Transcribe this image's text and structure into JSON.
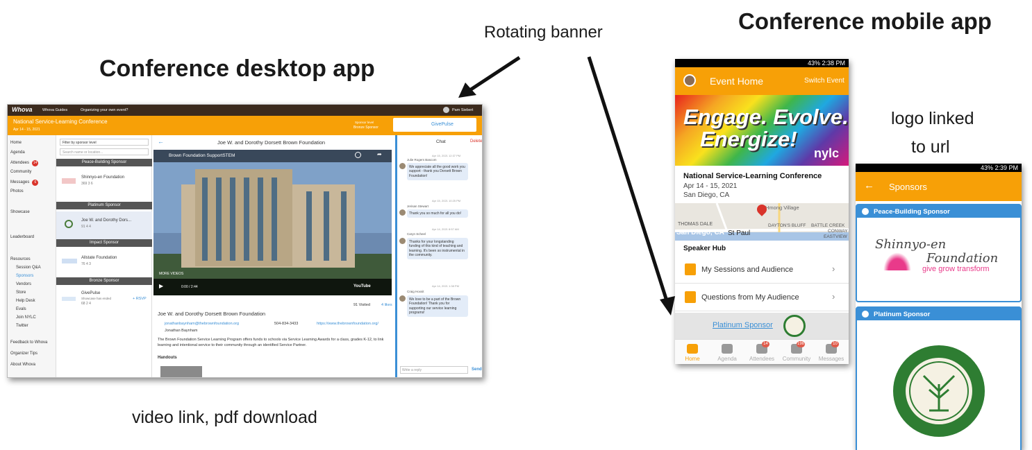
{
  "captions": {
    "desktop_title": "Conference desktop app",
    "mobile_title": "Conference mobile app",
    "rotating_banner": "Rotating banner",
    "logo_linked": "logo linked",
    "to_url": "to url",
    "video_link": "video link, pdf download"
  },
  "desktop": {
    "brand": "Whova",
    "menu_guides": "Whova Guides",
    "menu_organize": "Organizing your own event?",
    "user": "Pam Siebert",
    "event_name": "National Service-Learning Conference",
    "event_dates": "Apr 14 - 15, 2021",
    "sponsor_level_label": "Sponsor level",
    "sponsor_level": "Bronze Sponsor",
    "banner_logo": "GivePulse",
    "nav": [
      "Home",
      "Agenda",
      "Attendees",
      "Community",
      "Messages",
      "Photos",
      "Showcase",
      "Leaderboard",
      "Resources",
      "Session Q&A",
      "Sponsors",
      "Vendors",
      "Store",
      "Help Desk",
      "Evals",
      "Join NYLC",
      "Twitter",
      "Feedback to Whova",
      "Organizer Tips",
      "About Whova"
    ],
    "nav_badges": {
      "attendees": "14",
      "messages": "6"
    },
    "filter_placeholder": "Filter by sponsor level",
    "search_placeholder": "Search name or location...",
    "sections": [
      "Peace-Building Sponsor",
      "Platinum Sponsor",
      "Impact Sponsor",
      "Bronze Sponsor"
    ],
    "sponsors": [
      {
        "name": "Shinnyo-en Foundation",
        "stats": "369  3  6"
      },
      {
        "name": "Joe W. and Dorothy Dors...",
        "stats": "91  4  4"
      },
      {
        "name": "Allstate Foundation",
        "stats": "76  4  3"
      },
      {
        "name": "GivePulse",
        "sub": "Showcase has ended",
        "stats": "68  2  4",
        "rsvp": "+ RSVP"
      }
    ],
    "detail_title": "Joe W. and Dorothy Dorsett Brown Foundation",
    "video_title": "Brown Foundation SupportSTEM",
    "video_more": "MORE VIDEOS",
    "video_time": "0:00 / 2:44",
    "video_watch_later": "Watch later",
    "video_share": "Share",
    "video_youtube": "YouTube",
    "visited": "91 Visited",
    "likes": "4 likes",
    "org_name": "Joe W. and Dorothy Dorsett Brown Foundation",
    "email": "jonathanbaynham@thebrownfoundation.org",
    "phone": "504-834-3433",
    "website": "https://www.thebrownfoundation.org/",
    "contact": "Jonathan Baynham",
    "description": "The Brown Foundation Service Learning Program offers funds to schools via Service Learning Awards for a class, grades K-12, to link learning and intentional service to their community through an identified Service Partner.",
    "handouts": "Handouts",
    "chat_title": "Chat",
    "chat_delete": "Delete",
    "chat_messages": [
      {
        "time": "Apr 15, 2021 12:37 PM",
        "name": "Julie Rogers Bascom",
        "text": "We appreciate all the good work you support - thank you Dorsett Brown Foundation!"
      },
      {
        "time": "Apr 15, 2021 10:25 PM",
        "name": "Jerisan Stewart",
        "text": "Thank you so much for all you do!"
      },
      {
        "time": "Apr 14, 2021 8:57 AM",
        "name": "Caryn Scheel",
        "text": "Thanks for your longstanding funding of this kind of teaching and learning. It's been so instrumental in the community."
      },
      {
        "time": "Apr 14, 2021 1:38 PM",
        "name": "Craig Hoxsit",
        "text": "We love to be a part of the Brown Foundation! Thank you for supporting our service learning programs!"
      }
    ],
    "reply_placeholder": "Write a reply",
    "send": "Send"
  },
  "mobile_home": {
    "status": "43%  2:38 PM",
    "title": "Event Home",
    "switch": "Switch Event",
    "banner_line1": "Engage. Evolve.",
    "banner_line2": "Energize!",
    "banner_brand": "nylc",
    "event_name": "National Service-Learning Conference",
    "dates": "Apr 14 - 15, 2021",
    "location": "San Diego, CA",
    "map_labels": [
      "THOMAS  DALE",
      "San Diego, CA",
      "St Paul",
      "DAYTON'S BLUFF",
      "BATTLE CREEK",
      "CONWAY",
      "EASTVIEW",
      "Hmong Village"
    ],
    "speaker_hub": "Speaker Hub",
    "rows": [
      "My Sessions and Audience",
      "Questions from My Audience"
    ],
    "platinum_link": "Platinum Sponsor",
    "tabs": [
      "Home",
      "Agenda",
      "Attendees",
      "Community",
      "Messages"
    ],
    "tab_badges": [
      "14",
      "198",
      "10"
    ]
  },
  "mobile_sponsors": {
    "status": "43%  2:39 PM",
    "title": "Sponsors",
    "section1": "Peace-Building Sponsor",
    "logo1_line1": "Shinnyo-en",
    "logo1_line2": "Foundation",
    "logo1_tag": "give  grow  transform",
    "section2": "Platinum Sponsor"
  },
  "colors": {
    "orange": "#f7a007",
    "blue": "#3a8fd6",
    "dark": "#3b2a1d"
  }
}
